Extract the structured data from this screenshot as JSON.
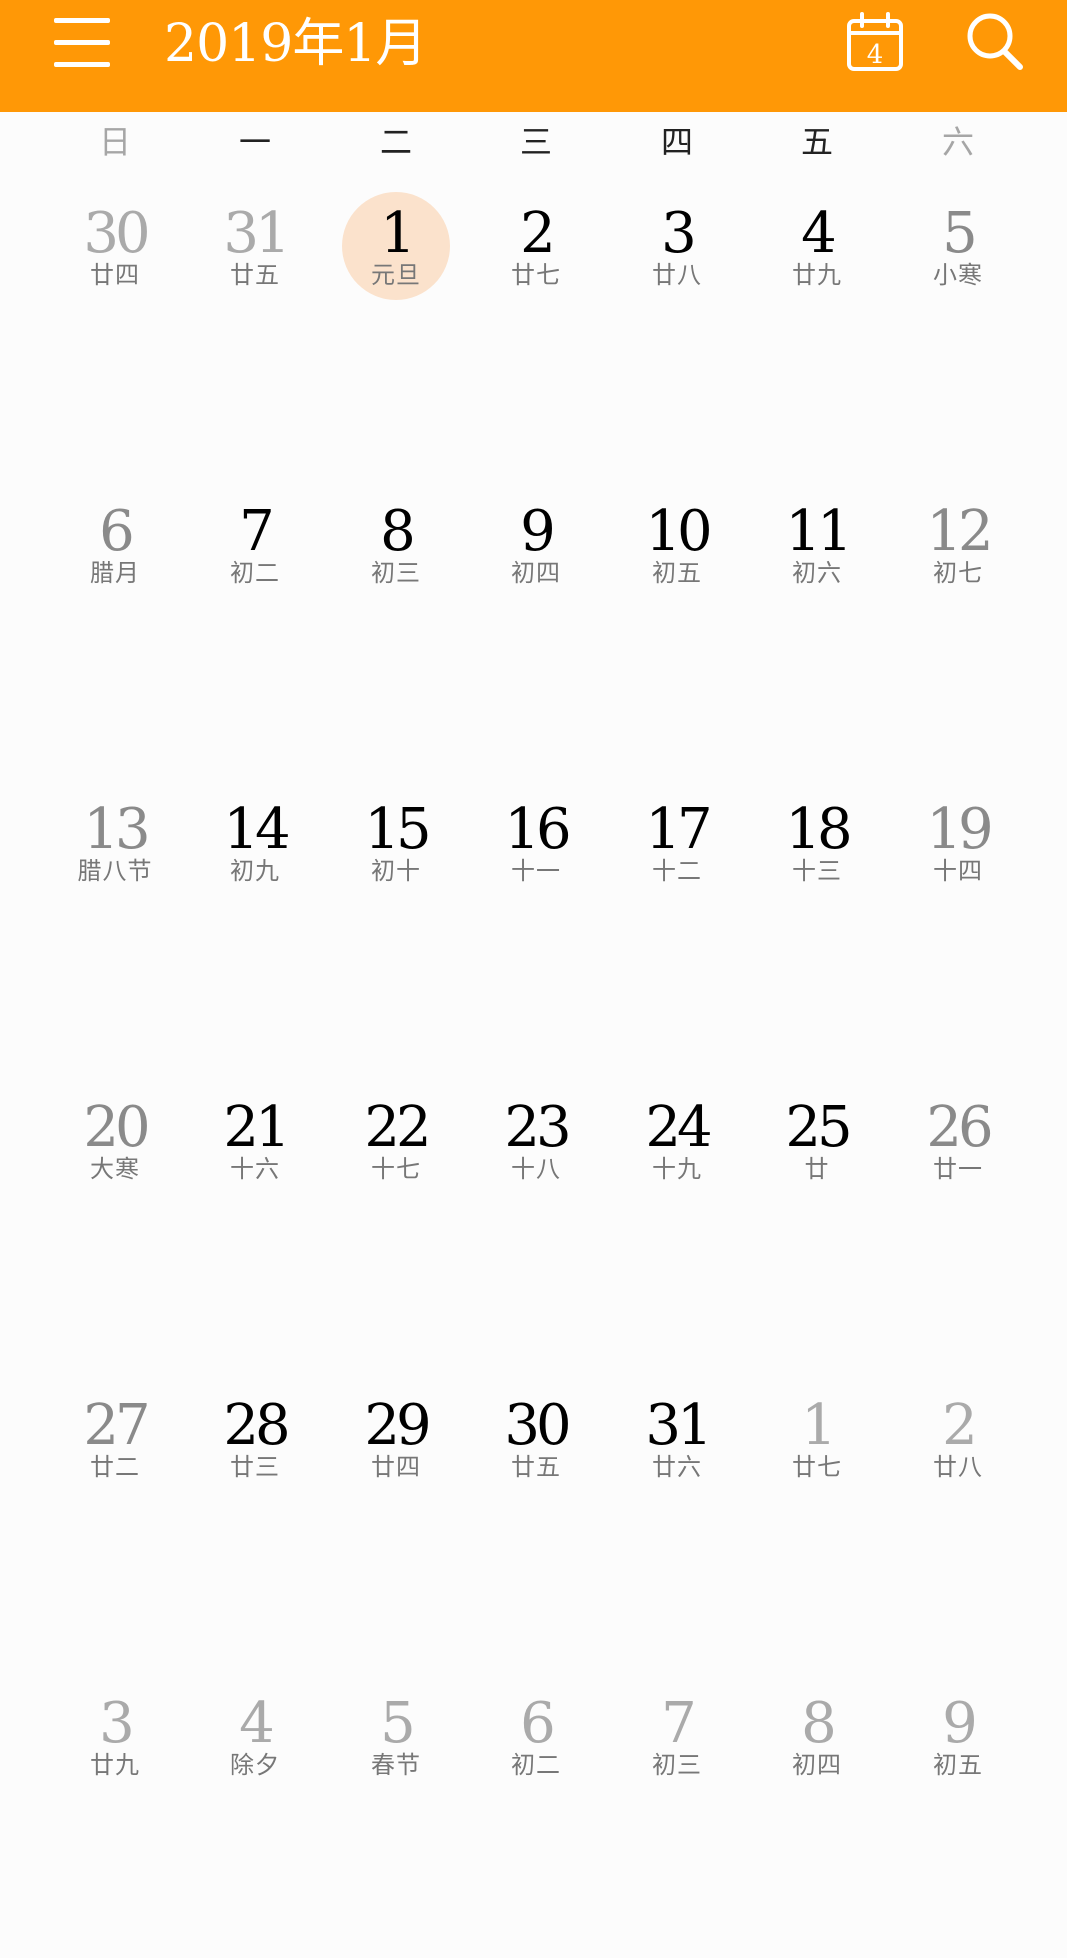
{
  "header": {
    "title": "2019年1月",
    "today_number": "4",
    "background_color": "#ff9806",
    "menu_icon": "hamburger-menu-icon",
    "today_icon": "calendar-today-icon",
    "search_icon": "search-icon"
  },
  "colors": {
    "weekday_text": "#000000",
    "weekend_text": "#8a8a8a",
    "other_month_text": "#aaaaaa",
    "weekday_header_normal": "#222222",
    "weekday_header_weekend": "#a6a6a6",
    "lunar_weekday": "#777777",
    "selected_circle": "#fbe2cc"
  },
  "weekdays": [
    {
      "label": "日",
      "weekend": true
    },
    {
      "label": "一",
      "weekend": false
    },
    {
      "label": "二",
      "weekend": false
    },
    {
      "label": "三",
      "weekend": false
    },
    {
      "label": "四",
      "weekend": false
    },
    {
      "label": "五",
      "weekend": false
    },
    {
      "label": "六",
      "weekend": true
    }
  ],
  "weeks": [
    [
      {
        "day": "30",
        "lunar": "廿四",
        "current_month": false
      },
      {
        "day": "31",
        "lunar": "廿五",
        "current_month": false
      },
      {
        "day": "1",
        "lunar": "元旦",
        "current_month": true,
        "selected": true
      },
      {
        "day": "2",
        "lunar": "廿七",
        "current_month": true
      },
      {
        "day": "3",
        "lunar": "廿八",
        "current_month": true
      },
      {
        "day": "4",
        "lunar": "廿九",
        "current_month": true
      },
      {
        "day": "5",
        "lunar": "小寒",
        "current_month": true
      }
    ],
    [
      {
        "day": "6",
        "lunar": "腊月",
        "current_month": true
      },
      {
        "day": "7",
        "lunar": "初二",
        "current_month": true
      },
      {
        "day": "8",
        "lunar": "初三",
        "current_month": true
      },
      {
        "day": "9",
        "lunar": "初四",
        "current_month": true
      },
      {
        "day": "10",
        "lunar": "初五",
        "current_month": true
      },
      {
        "day": "11",
        "lunar": "初六",
        "current_month": true
      },
      {
        "day": "12",
        "lunar": "初七",
        "current_month": true
      }
    ],
    [
      {
        "day": "13",
        "lunar": "腊八节",
        "current_month": true
      },
      {
        "day": "14",
        "lunar": "初九",
        "current_month": true
      },
      {
        "day": "15",
        "lunar": "初十",
        "current_month": true
      },
      {
        "day": "16",
        "lunar": "十一",
        "current_month": true
      },
      {
        "day": "17",
        "lunar": "十二",
        "current_month": true
      },
      {
        "day": "18",
        "lunar": "十三",
        "current_month": true
      },
      {
        "day": "19",
        "lunar": "十四",
        "current_month": true
      }
    ],
    [
      {
        "day": "20",
        "lunar": "大寒",
        "current_month": true
      },
      {
        "day": "21",
        "lunar": "十六",
        "current_month": true
      },
      {
        "day": "22",
        "lunar": "十七",
        "current_month": true
      },
      {
        "day": "23",
        "lunar": "十八",
        "current_month": true
      },
      {
        "day": "24",
        "lunar": "十九",
        "current_month": true
      },
      {
        "day": "25",
        "lunar": "廿",
        "current_month": true
      },
      {
        "day": "26",
        "lunar": "廿一",
        "current_month": true
      }
    ],
    [
      {
        "day": "27",
        "lunar": "廿二",
        "current_month": true
      },
      {
        "day": "28",
        "lunar": "廿三",
        "current_month": true
      },
      {
        "day": "29",
        "lunar": "廿四",
        "current_month": true
      },
      {
        "day": "30",
        "lunar": "廿五",
        "current_month": true
      },
      {
        "day": "31",
        "lunar": "廿六",
        "current_month": true
      },
      {
        "day": "1",
        "lunar": "廿七",
        "current_month": false
      },
      {
        "day": "2",
        "lunar": "廿八",
        "current_month": false
      }
    ],
    [
      {
        "day": "3",
        "lunar": "廿九",
        "current_month": false
      },
      {
        "day": "4",
        "lunar": "除夕",
        "current_month": false
      },
      {
        "day": "5",
        "lunar": "春节",
        "current_month": false
      },
      {
        "day": "6",
        "lunar": "初二",
        "current_month": false
      },
      {
        "day": "7",
        "lunar": "初三",
        "current_month": false
      },
      {
        "day": "8",
        "lunar": "初四",
        "current_month": false
      },
      {
        "day": "9",
        "lunar": "初五",
        "current_month": false
      }
    ]
  ]
}
